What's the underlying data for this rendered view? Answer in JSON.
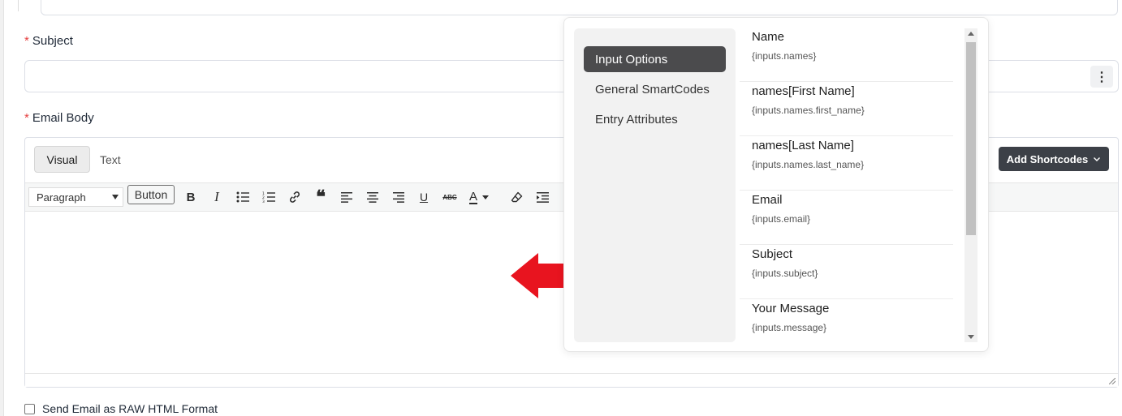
{
  "form": {
    "subject_label": "Subject",
    "email_body_label": "Email Body",
    "required_marker": "*",
    "subject_value": "",
    "raw_html_label": "Send Email as RAW HTML Format"
  },
  "editor": {
    "tabs": [
      {
        "label": "Visual",
        "active": true
      },
      {
        "label": "Text",
        "active": false
      }
    ],
    "add_shortcodes_label": "Add Shortcodes",
    "paragraph_select": "Paragraph",
    "button_label": "Button",
    "toolbar_icons": [
      "bold-icon",
      "italic-icon",
      "bullet-list-icon",
      "numbered-list-icon",
      "link-icon",
      "blockquote-icon",
      "align-left-icon",
      "align-center-icon",
      "align-right-icon",
      "underline-icon",
      "strikethrough-icon",
      "text-color-icon",
      "clear-formatting-icon",
      "indent-icon"
    ]
  },
  "popover": {
    "nav": [
      {
        "label": "Input Options",
        "active": true
      },
      {
        "label": "General SmartCodes",
        "active": false
      },
      {
        "label": "Entry Attributes",
        "active": false
      }
    ],
    "items": [
      {
        "title": "Name",
        "code": "{inputs.names}"
      },
      {
        "title": "names[First Name]",
        "code": "{inputs.names.first_name}"
      },
      {
        "title": "names[Last Name]",
        "code": "{inputs.names.last_name}"
      },
      {
        "title": "Email",
        "code": "{inputs.email}"
      },
      {
        "title": "Subject",
        "code": "{inputs.subject}"
      },
      {
        "title": "Your Message",
        "code": "{inputs.message}"
      }
    ]
  },
  "colors": {
    "arrow": "#e8141f",
    "required": "#e53e3e",
    "dark_button": "#3c4047",
    "active_nav": "#4b4b4d"
  }
}
